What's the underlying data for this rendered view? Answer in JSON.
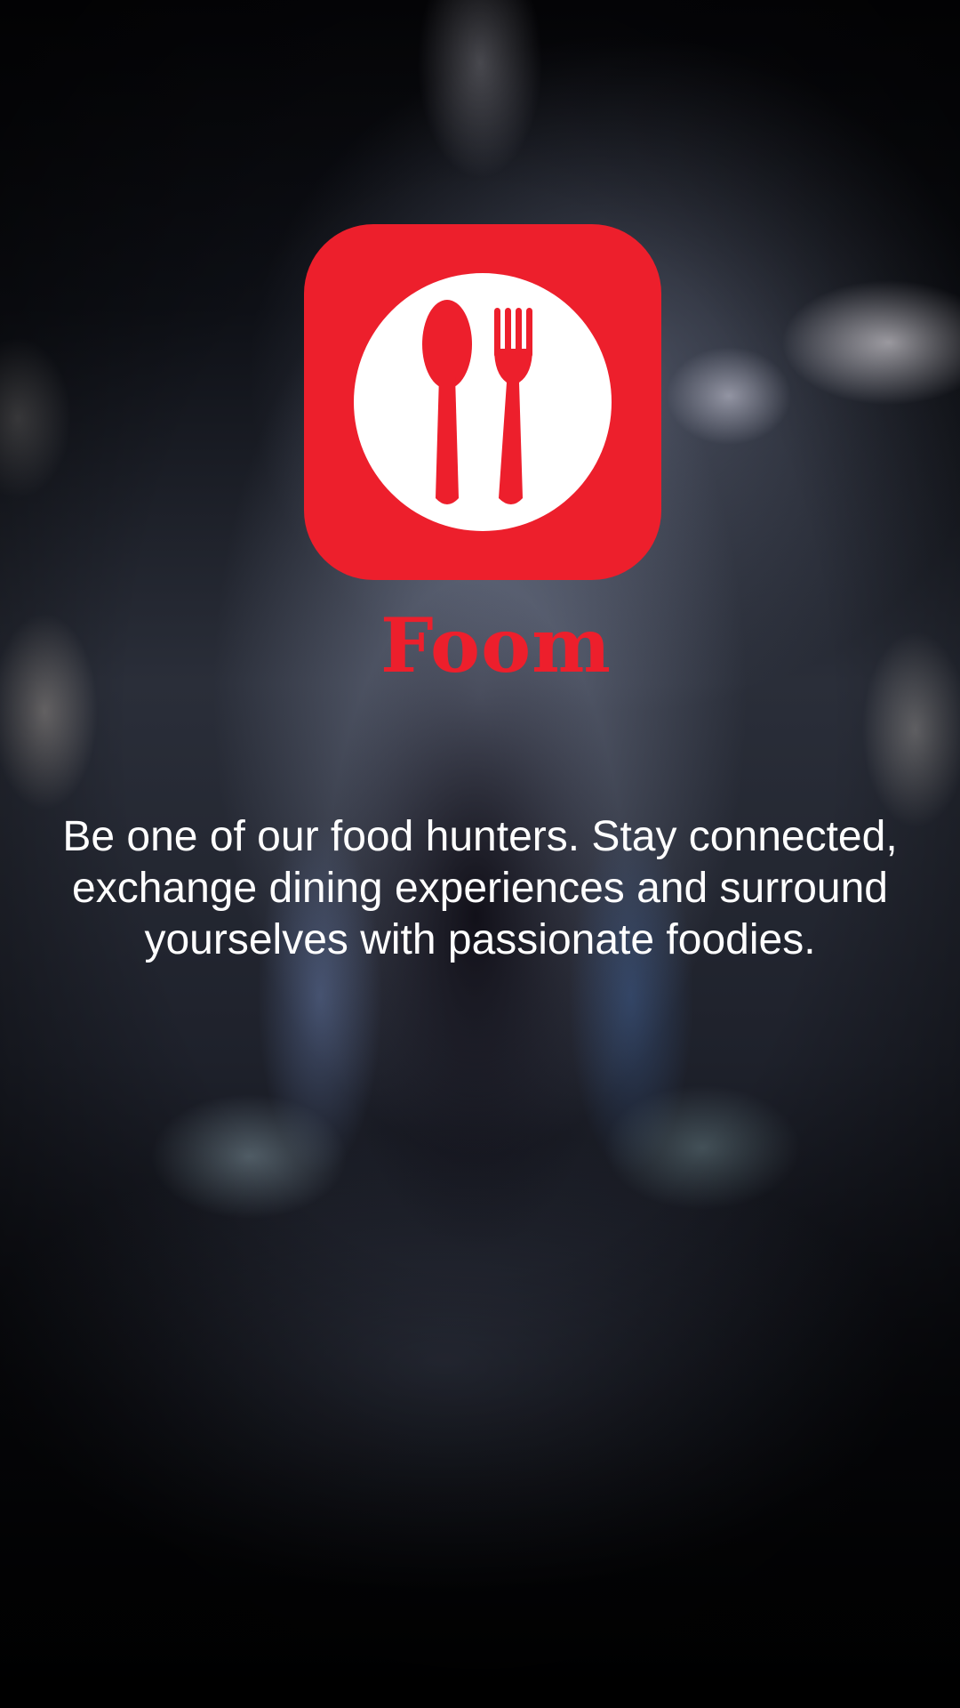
{
  "app": {
    "name": "Foom",
    "brand_color": "#ED1F2C",
    "icon": "spoon-and-fork-icon"
  },
  "tagline": "Be one of our food hunters. Stay connected, exchange dining experiences and surround yourselves with passionate foodies."
}
